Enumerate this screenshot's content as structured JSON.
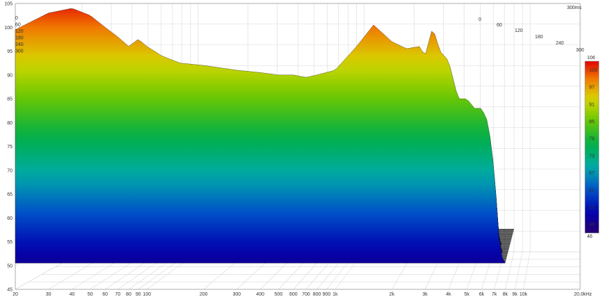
{
  "chart_data": {
    "type": "area",
    "subtype": "waterfall-3d",
    "time_label": "300ms",
    "x_unit_label": "20.0kHz",
    "x_ticks": [
      "20",
      "30",
      "40",
      "50",
      "60",
      "70",
      "80",
      "90",
      "100",
      "200",
      "300",
      "400",
      "500",
      "600",
      "700",
      "800",
      "900",
      "1k",
      "2k",
      "3k",
      "4k",
      "5k",
      "6k",
      "7k",
      "8k",
      "9k",
      "10k"
    ],
    "x_tick_values": [
      20,
      30,
      40,
      50,
      60,
      70,
      80,
      90,
      100,
      200,
      300,
      400,
      500,
      600,
      700,
      800,
      900,
      1000,
      2000,
      3000,
      4000,
      5000,
      6000,
      7000,
      8000,
      9000,
      10000
    ],
    "x_range": [
      20,
      20000
    ],
    "x_scale": "log",
    "y_ticks": [
      "105",
      "100",
      "95",
      "90",
      "85",
      "80",
      "75",
      "70",
      "65",
      "60",
      "55",
      "50",
      "45"
    ],
    "y_range": [
      45,
      105
    ],
    "depth_ticks": [
      "0",
      "60",
      "120",
      "180",
      "240",
      "300"
    ],
    "depth_ticks_back": [
      "0",
      "60",
      "120",
      "180",
      "240",
      "300"
    ],
    "colorbar": {
      "ticks": [
        "106",
        "103",
        "97",
        "91",
        "85",
        "79",
        "73",
        "67",
        "61",
        "55",
        "49",
        "46"
      ],
      "range": [
        46,
        106
      ]
    },
    "grid": true,
    "series": [
      {
        "slice_ms": 0,
        "freq_hz": [
          20,
          30,
          40,
          50,
          60,
          70,
          80,
          90,
          100,
          120,
          150,
          200,
          300,
          400,
          500,
          600,
          700,
          800,
          1000,
          1300,
          1600,
          2000,
          2400,
          2800,
          3000,
          3300,
          3600,
          4000,
          4500,
          5000,
          5500,
          6000,
          6500,
          7000,
          7500,
          8000
        ],
        "spl_db": [
          99.5,
          103,
          104,
          102.5,
          100,
          98,
          96,
          97.5,
          96,
          94,
          92.5,
          92,
          91,
          90.5,
          90,
          90,
          89.5,
          90,
          91,
          96,
          100.5,
          97,
          95.5,
          96,
          94,
          100,
          95,
          93,
          85,
          85,
          83,
          83,
          80,
          70,
          53,
          50
        ]
      }
    ]
  }
}
